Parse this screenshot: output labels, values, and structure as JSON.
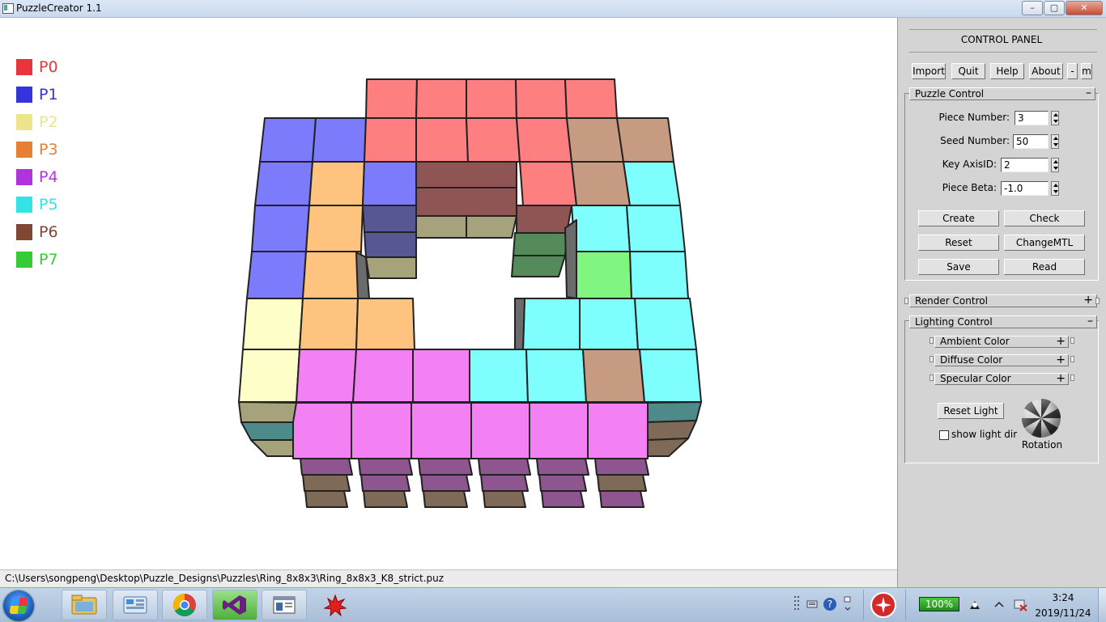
{
  "window": {
    "title": "PuzzleCreator 1.1",
    "btn_min": "–",
    "btn_max": "▢",
    "btn_close": "✕"
  },
  "legend": [
    {
      "label": "P0",
      "color": "#e8343c"
    },
    {
      "label": "P1",
      "color": "#3434dc"
    },
    {
      "label": "P2",
      "color": "#ece58c"
    },
    {
      "label": "P3",
      "color": "#e88034"
    },
    {
      "label": "P4",
      "color": "#b034dc"
    },
    {
      "label": "P5",
      "color": "#34e4e4"
    },
    {
      "label": "P6",
      "color": "#804834"
    },
    {
      "label": "P7",
      "color": "#34cc34"
    }
  ],
  "status": {
    "path": "C:\\Users\\songpeng\\Desktop\\Puzzle_Designs\\Puzzles\\Ring_8x8x3\\Ring_8x8x3_K8_strict.puz"
  },
  "panel": {
    "title": "CONTROL PANEL",
    "top_buttons": [
      "Import",
      "Quit",
      "Help",
      "About",
      "-",
      "m"
    ],
    "puzzle_control": {
      "title": "Puzzle Control",
      "toggle": "–",
      "fields": [
        {
          "label": "Piece Number:",
          "value": "3"
        },
        {
          "label": "Seed Number:",
          "value": "50"
        },
        {
          "label": "Key AxisID:",
          "value": "2"
        },
        {
          "label": "Piece Beta:",
          "value": "-1.0"
        }
      ],
      "buttons": [
        "Create",
        "Check",
        "Reset",
        "ChangeMTL",
        "Save",
        "Read"
      ]
    },
    "render_control": {
      "title": "Render Control",
      "toggle": "+"
    },
    "lighting_control": {
      "title": "Lighting Control",
      "toggle": "–",
      "sub": [
        {
          "title": "Ambient Color",
          "toggle": "+"
        },
        {
          "title": "Diffuse Color",
          "toggle": "+"
        },
        {
          "title": "Specular Color",
          "toggle": "+"
        }
      ],
      "reset_light": "Reset Light",
      "show_light_dir": "show light dir",
      "show_light_dir_checked": false,
      "rotation_label": "Rotation"
    }
  },
  "taskbar": {
    "apps": [
      "file-explorer",
      "control-panel",
      "chrome",
      "visual-studio",
      "puzzle-app",
      "paint-tool"
    ],
    "battery": "100%",
    "time": "3:24",
    "date": "2019/11/24"
  }
}
